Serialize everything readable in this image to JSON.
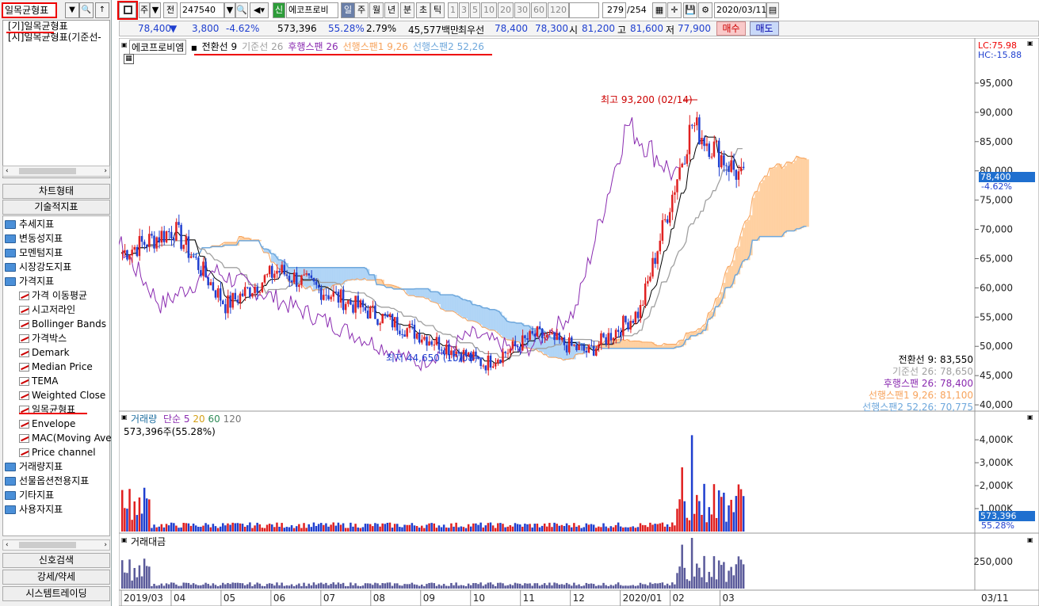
{
  "left_panel": {
    "search_value": "일목균형표",
    "list_items": [
      "[기]일목균형표",
      "[시]일목균형표(기준선-"
    ],
    "buttons": [
      "차트형태",
      "기술적지표"
    ],
    "tree": [
      {
        "type": "folder",
        "label": "추세지표"
      },
      {
        "type": "folder",
        "label": "변동성지표"
      },
      {
        "type": "folder",
        "label": "모멘텀지표"
      },
      {
        "type": "folder",
        "label": "시장강도지표"
      },
      {
        "type": "folder",
        "label": "가격지표"
      },
      {
        "type": "item",
        "label": "가격 이동평균"
      },
      {
        "type": "item",
        "label": "시고저라인"
      },
      {
        "type": "item",
        "label": "Bollinger Bands"
      },
      {
        "type": "item",
        "label": "가격박스"
      },
      {
        "type": "item",
        "label": "Demark"
      },
      {
        "type": "item",
        "label": "Median Price"
      },
      {
        "type": "item",
        "label": "TEMA"
      },
      {
        "type": "item",
        "label": "Weighted Close"
      },
      {
        "type": "item",
        "label": "일목균형표"
      },
      {
        "type": "item",
        "label": "Envelope"
      },
      {
        "type": "item",
        "label": "MAC(Moving Ave"
      },
      {
        "type": "item",
        "label": "Price channel"
      },
      {
        "type": "folder",
        "label": "거래량지표"
      },
      {
        "type": "folder",
        "label": "선물옵션전용지표"
      },
      {
        "type": "folder",
        "label": "기타지표"
      },
      {
        "type": "folder",
        "label": "사용자지표"
      }
    ],
    "bottom_buttons": [
      "신호검색",
      "강세/약세",
      "시스템트레이딩"
    ]
  },
  "toolbar": {
    "period_label": "주",
    "prev_label": "전",
    "code": "247540",
    "sin_badge": "신",
    "stock_name": "에코프로비",
    "periods": [
      "일",
      "주",
      "월",
      "년",
      "분",
      "초",
      "틱"
    ],
    "intervals": [
      "1",
      "3",
      "5",
      "10",
      "20",
      "30",
      "60",
      "120"
    ],
    "count": "279",
    "count_total": "/254",
    "date": "2020/03/11"
  },
  "quote": {
    "price": "78,400",
    "arrow": "▼",
    "change": "3,800",
    "change_pct": "-4.62%",
    "volume": "573,396",
    "vol_pct": "55.28%",
    "ratio": "2.79%",
    "amount": "45,577백만",
    "best_label": "최우선",
    "ask": "78,400",
    "bid": "78,300",
    "open_label": "시",
    "open": "81,200",
    "high_label": "고",
    "high": "81,600",
    "low_label": "저",
    "low": "77,900",
    "buy": "매수",
    "sell": "매도"
  },
  "chart_title": "에코프로비엠",
  "ichimoku_legend": [
    {
      "label": "전환선 9",
      "color": "#000000"
    },
    {
      "label": "기준선 26",
      "color": "#a0a0a0"
    },
    {
      "label": "후행스팬 26",
      "color": "#8a2bb0"
    },
    {
      "label": "선행스팬1 9,26",
      "color": "#f7a35c"
    },
    {
      "label": "선행스팬2 52,26",
      "color": "#6fa8dc"
    }
  ],
  "values_box": [
    {
      "label": "전환선 9:",
      "value": "83,550",
      "color": "#000000"
    },
    {
      "label": "기준선 26:",
      "value": "78,650",
      "color": "#a0a0a0"
    },
    {
      "label": "후행스팬 26:",
      "value": "78,400",
      "color": "#8a2bb0"
    },
    {
      "label": "선행스팬1 9,26:",
      "value": "81,100",
      "color": "#f7a35c"
    },
    {
      "label": "선행스팬2 52,26:",
      "value": "70,775",
      "color": "#6fa8dc"
    }
  ],
  "lc": "LC:75.98",
  "hc": "HC:-15.88",
  "high_annot": "최고 93,200 (02/14)",
  "low_annot": "최저 44,650 (10/08)",
  "current_price_tag": "78,400",
  "current_pct_tag": "-4.62%",
  "volume_legend": {
    "label": "거래량",
    "ma_label": "단순",
    "mas": [
      "5",
      "20",
      "60",
      "120"
    ],
    "desc": "573,396주(55.28%)"
  },
  "volume_tag": "573,396",
  "volume_pct_tag": "55.28%",
  "amount_label": "거래대금",
  "x_labels": [
    "2019/03",
    "04",
    "05",
    "06",
    "07",
    "08",
    "09",
    "10",
    "11",
    "12",
    "2020/01",
    "02",
    "03"
  ],
  "x_last": "03/11",
  "colors": {
    "up": "#e02020",
    "down": "#1f3fcf",
    "accent_red": "#e00000"
  },
  "chart_data": {
    "type": "candlestick",
    "price_axis": {
      "labels": [
        "95,000",
        "90,000",
        "85,000",
        "80,000",
        "75,000",
        "70,000",
        "65,000",
        "60,000",
        "55,000",
        "50,000",
        "45,000",
        "40,000"
      ],
      "ylim": [
        35000,
        100000
      ]
    },
    "volume_axis": {
      "labels": [
        "4,000K",
        "3,000K",
        "2,000K",
        "1,000K"
      ],
      "ylim": [
        0,
        4800000
      ]
    },
    "amount_axis": {
      "labels": [
        "250,000"
      ],
      "ylim": [
        0,
        400000
      ]
    },
    "close_keypoints": [
      {
        "x": "2019/03",
        "y": 66000
      },
      {
        "x": "2019/04",
        "y": 70000
      },
      {
        "x": "2019/05",
        "y": 57000
      },
      {
        "x": "2019/06",
        "y": 63000
      },
      {
        "x": "2019/07",
        "y": 59000
      },
      {
        "x": "2019/08",
        "y": 55000
      },
      {
        "x": "2019/09",
        "y": 51000
      },
      {
        "x": "2019/10",
        "y": 47000
      },
      {
        "x": "2019/11",
        "y": 52000
      },
      {
        "x": "2019/12",
        "y": 49000
      },
      {
        "x": "2020/01",
        "y": 56000
      },
      {
        "x": "2020/02",
        "y": 88000
      },
      {
        "x": "2020/03",
        "y": 78400
      }
    ]
  }
}
